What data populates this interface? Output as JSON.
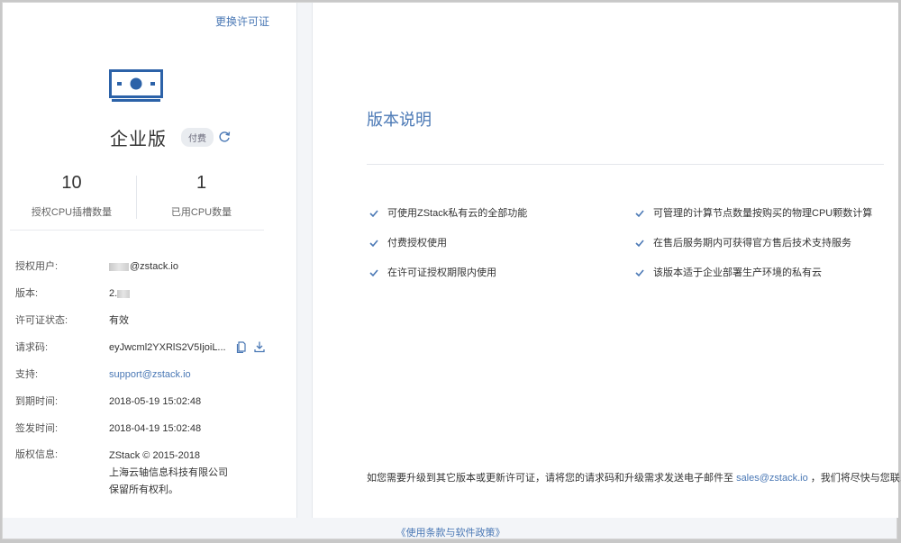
{
  "left_panel": {
    "change_license_link": "更换许可证",
    "edition": "企业版",
    "badge": "付费",
    "stats": [
      {
        "value": "10",
        "label": "授权CPU插槽数量"
      },
      {
        "value": "1",
        "label": "已用CPU数量"
      }
    ],
    "info": {
      "user": {
        "label": "授权用户:",
        "value": "@zstack.io"
      },
      "version": {
        "label": "版本:",
        "value": "2."
      },
      "status": {
        "label": "许可证状态:",
        "value": "有效"
      },
      "request_code": {
        "label": "请求码:",
        "value": "eyJwcml2YXRlS2V5IjoiL..."
      },
      "support": {
        "label": "支持:",
        "value": "support@zstack.io"
      },
      "expire": {
        "label": "到期时间:",
        "value": "2018-05-19 15:02:48"
      },
      "issued": {
        "label": "签发时间:",
        "value": "2018-04-19 15:02:48"
      },
      "copyright": {
        "label": "版权信息:",
        "lines": [
          "ZStack © 2015-2018",
          "上海云轴信息科技有限公司",
          "保留所有权利。"
        ]
      }
    }
  },
  "right_panel": {
    "title": "版本说明",
    "features": [
      "可使用ZStack私有云的全部功能",
      "可管理的计算节点数量按购买的物理CPU颗数计算",
      "付费授权使用",
      "在售后服务期内可获得官方售后技术支持服务",
      "在许可证授权期限内使用",
      "该版本适于企业部署生产环境的私有云"
    ],
    "contact": {
      "prefix": "如您需要升级到其它版本或更新许可证，请将您的请求码和升级需求发送电子邮件至",
      "email": "sales@zstack.io",
      "suffix": "，我们将尽快与您联系！"
    }
  },
  "footer": {
    "terms_link": "《使用条款与软件政策》"
  },
  "colors": {
    "accent": "#4a78b5",
    "icon_blue": "#2c62a8"
  }
}
